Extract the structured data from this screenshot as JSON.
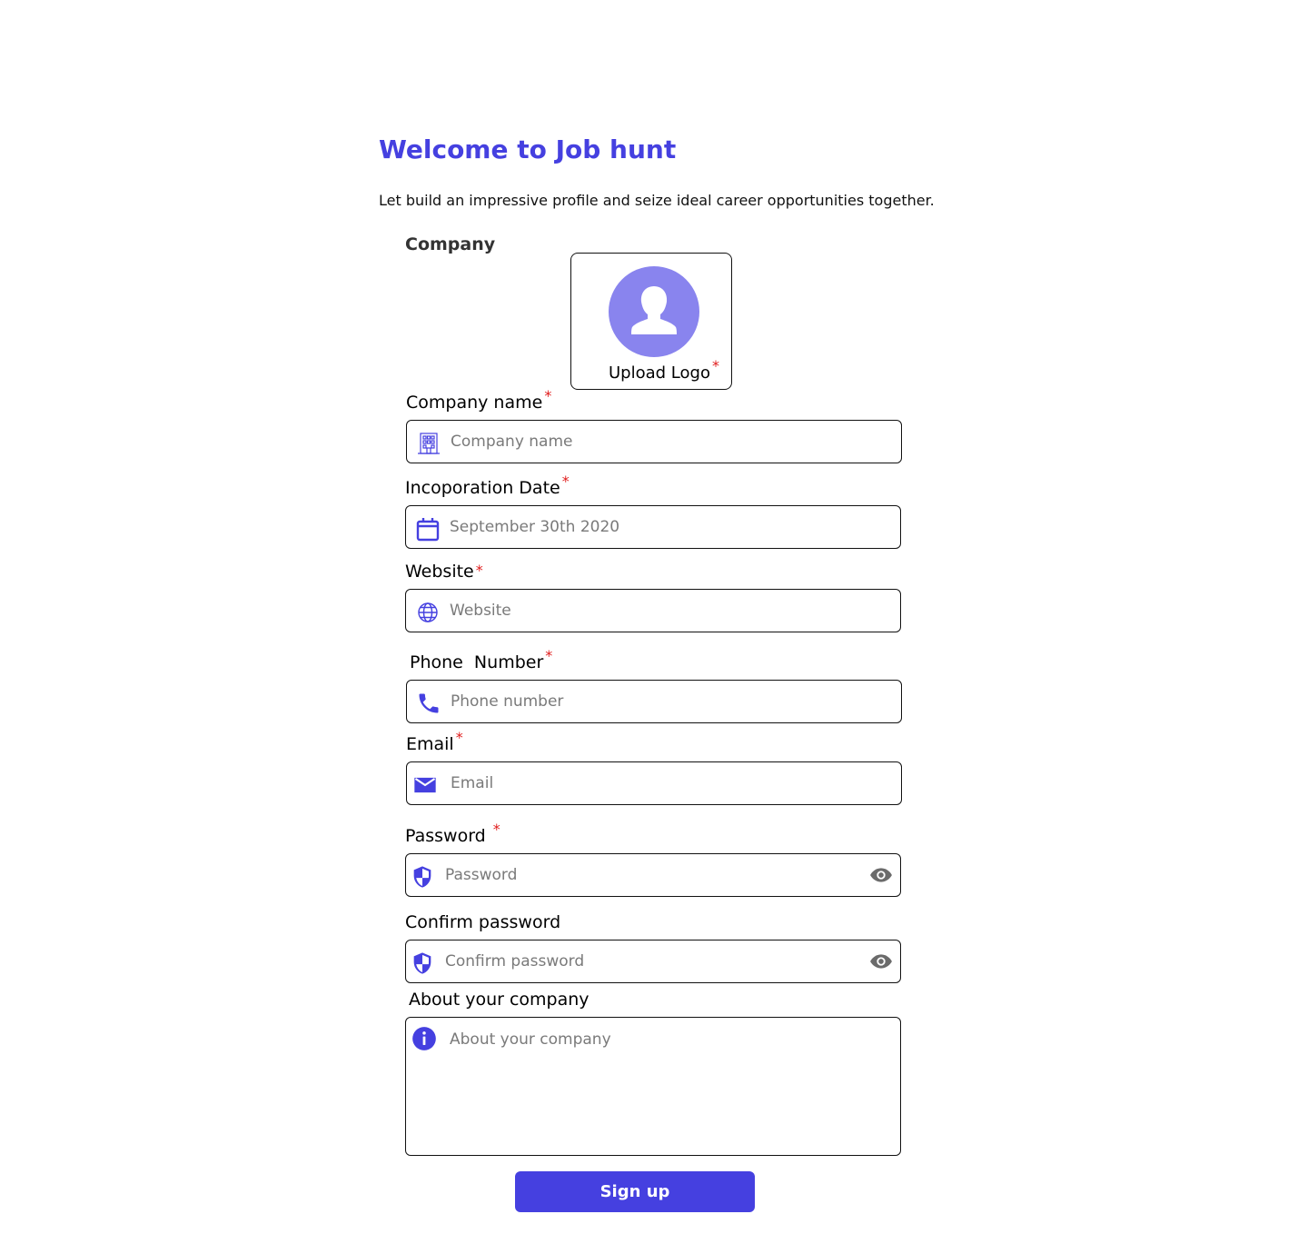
{
  "header": {
    "title": "Welcome to Job hunt",
    "subtitle": "Let build an impressive profile and seize ideal career opportunities together."
  },
  "section_title": "Company",
  "upload": {
    "label": "Upload Logo",
    "required_mark": "*"
  },
  "fields": {
    "company_name": {
      "label": "Company name",
      "placeholder": "Company name",
      "required_mark": "*",
      "icon": "building-icon"
    },
    "incorporation_date": {
      "label": "Incoporation Date",
      "placeholder": "September 30th 2020",
      "required_mark": "*",
      "icon": "calendar-icon"
    },
    "website": {
      "label": "Website",
      "placeholder": "Website",
      "required_mark": "*",
      "icon": "globe-icon"
    },
    "phone": {
      "label": "Phone  Number",
      "placeholder": "Phone number",
      "required_mark": "*",
      "icon": "phone-icon"
    },
    "email": {
      "label": "Email",
      "placeholder": "Email",
      "required_mark": "*",
      "icon": "mail-icon"
    },
    "password": {
      "label": "Password",
      "placeholder": "Password",
      "required_mark": "*",
      "icon": "shield-icon"
    },
    "confirm_password": {
      "label": "Confirm password",
      "placeholder": "Confirm password",
      "icon": "shield-icon"
    },
    "about": {
      "label": "About your company",
      "placeholder": "About your company",
      "icon": "info-icon"
    }
  },
  "submit": {
    "label": "Sign up"
  },
  "colors": {
    "accent": "#4540e0",
    "avatar": "#8984ee",
    "required": "#e01b1b",
    "eye": "#6b6b6b"
  }
}
